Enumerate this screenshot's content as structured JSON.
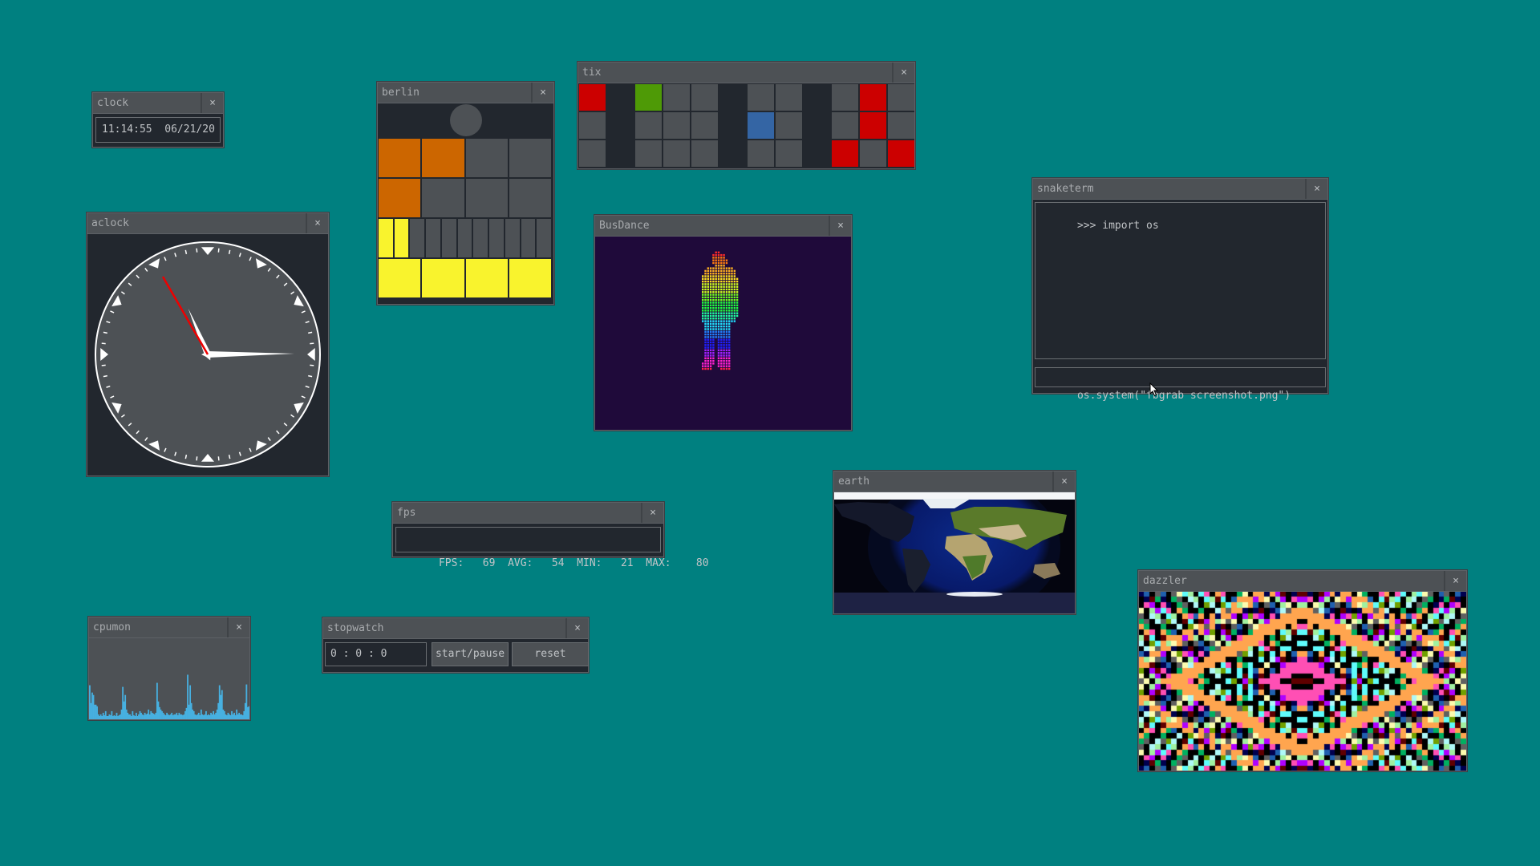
{
  "desktop": {
    "background": "#008080"
  },
  "windows": {
    "clock": {
      "title": "clock",
      "close": "×",
      "time": "11:14:55",
      "date": "06/21/20"
    },
    "aclock": {
      "title": "aclock",
      "close": "×",
      "hours": 11,
      "minutes": 14,
      "seconds": 55
    },
    "berlin": {
      "title": "berlin",
      "close": "×",
      "seconds_lamp_on": false,
      "five_hours_on": 2,
      "hours_on": 1,
      "five_minutes_on": 2,
      "minutes_on": 4,
      "colors": {
        "hours": "#cc6600",
        "minutes": "#f9f32d",
        "off": "#4d5155",
        "seconds_off": "#4d5155"
      }
    },
    "tix": {
      "title": "tix",
      "close": "×",
      "groups": [
        {
          "cols": 1,
          "color": "#cc0000",
          "on": [
            [
              0,
              0
            ]
          ]
        },
        {
          "cols": 3,
          "color": "#4e9a06",
          "on": [
            [
              0,
              0
            ]
          ]
        },
        {
          "cols": 2,
          "color": "#3465a4",
          "on": [
            [
              1,
              0
            ]
          ]
        },
        {
          "cols": 3,
          "color": "#cc0000",
          "on": [
            [
              0,
              1
            ],
            [
              1,
              1
            ],
            [
              2,
              0
            ],
            [
              2,
              2
            ]
          ]
        }
      ]
    },
    "busdance": {
      "title": "BusDance",
      "close": "×"
    },
    "snaketerm": {
      "title": "snaketerm",
      "close": "×",
      "output": ">>> import os",
      "input_value": "os.system(\"fbgrab screenshot.png\")"
    },
    "fps": {
      "title": "fps",
      "close": "×",
      "fps_label": "FPS:",
      "fps": "69",
      "avg_label": "AVG:",
      "avg": "54",
      "min_label": "MIN:",
      "min": "21",
      "max_label": "MAX:",
      "max": "80"
    },
    "earth": {
      "title": "earth",
      "close": "×"
    },
    "cpumon": {
      "title": "cpumon",
      "close": "×",
      "bar_color": "#47b0e0",
      "history": [
        0.42,
        0.2,
        0.33,
        0.3,
        0.18,
        0.18,
        0.16,
        0.06,
        0.04,
        0.06,
        0.04,
        0.08,
        0.05,
        0.1,
        0.04,
        0.04,
        0.06,
        0.05,
        0.1,
        0.04,
        0.05,
        0.04,
        0.08,
        0.04,
        0.05,
        0.06,
        0.12,
        0.4,
        0.22,
        0.3,
        0.12,
        0.08,
        0.06,
        0.06,
        0.04,
        0.1,
        0.05,
        0.04,
        0.08,
        0.04,
        0.06,
        0.1,
        0.08,
        0.06,
        0.05,
        0.08,
        0.06,
        0.07,
        0.12,
        0.06,
        0.1,
        0.08,
        0.07,
        0.06,
        0.08,
        0.45,
        0.22,
        0.15,
        0.12,
        0.1,
        0.08,
        0.06,
        0.05,
        0.08,
        0.06,
        0.05,
        0.06,
        0.08,
        0.05,
        0.06,
        0.06,
        0.08,
        0.05,
        0.08,
        0.06,
        0.06,
        0.05,
        0.06,
        0.1,
        0.14,
        0.55,
        0.18,
        0.42,
        0.2,
        0.12,
        0.1,
        0.06,
        0.05,
        0.06,
        0.08,
        0.05,
        0.12,
        0.06,
        0.05,
        0.06,
        0.1,
        0.05,
        0.06,
        0.05,
        0.08,
        0.06,
        0.1,
        0.06,
        0.08,
        0.12,
        0.2,
        0.42,
        0.3,
        0.36,
        0.12,
        0.1,
        0.06,
        0.05,
        0.08,
        0.06,
        0.05,
        0.1,
        0.06,
        0.08,
        0.05,
        0.12,
        0.06,
        0.08,
        0.06,
        0.06,
        0.05,
        0.1,
        0.2,
        0.43,
        0.15,
        0.16
      ]
    },
    "stopwatch": {
      "title": "stopwatch",
      "close": "×",
      "elapsed": "0 : 0 : 0",
      "start_pause_label": "start/pause",
      "reset_label": "reset"
    },
    "dazzler": {
      "title": "dazzler",
      "close": "×",
      "palette": [
        "#000000",
        "#ffa54f",
        "#5ffbfb",
        "#aef8f8",
        "#00b060",
        "#ff4fb4",
        "#a0f0a0",
        "#606060",
        "#00004f",
        "#b000ff",
        "#fbfbaf",
        "#1f60af",
        "#5f0000",
        "#70a000"
      ]
    }
  }
}
